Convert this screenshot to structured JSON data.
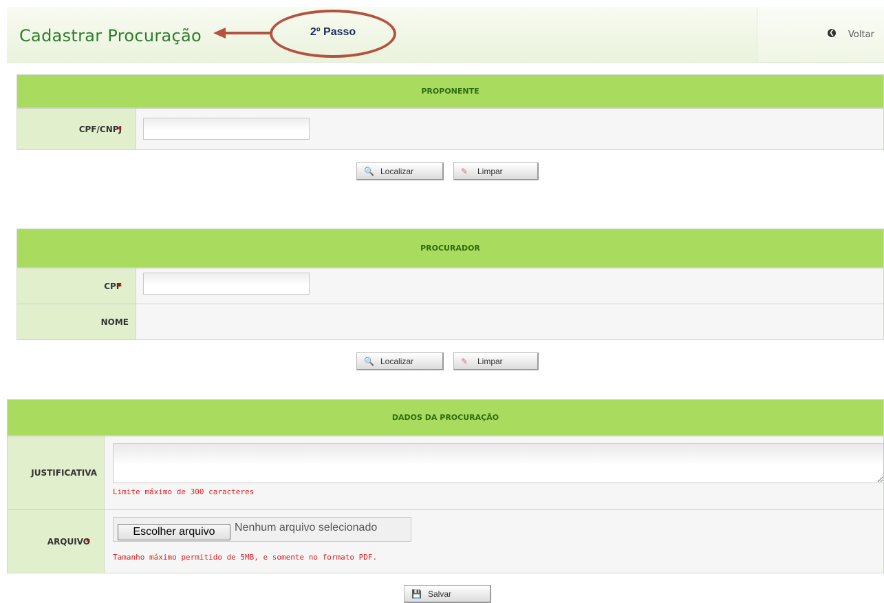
{
  "header": {
    "title": "Cadastrar Procuração",
    "annotation": "2º Passo",
    "back_label": "Voltar"
  },
  "proponente": {
    "heading": "PROPONENTE",
    "cpf_cnpj_label": "CPF/CNPJ",
    "required_mark": "*",
    "cpf_cnpj_value": "",
    "search_button": "Localizar",
    "clear_button": "Limpar"
  },
  "procurador": {
    "heading": "PROCURADOR",
    "cpf_label": "CPF",
    "required_mark": "*",
    "cpf_value": "",
    "nome_label": "NOME",
    "nome_value": "",
    "search_button": "Localizar",
    "clear_button": "Limpar"
  },
  "dados": {
    "heading": "DADOS DA PROCURAÇÃO",
    "justificativa_label": "JUSTIFICATIVA",
    "justificativa_value": "",
    "justificativa_hint": "Limite máximo de 300 caracteres",
    "arquivo_label": "ARQUIVO",
    "required_mark": "*",
    "file_button": "Escolher arquivo",
    "file_status": "Nenhum arquivo selecionado",
    "arquivo_hint": "Tamanho máximo permitido de 5MB, e somente no formato PDF."
  },
  "save_button": "Salvar",
  "colors": {
    "accent_green": "#a9dc5e",
    "title_green": "#2f7d2a",
    "annotation_red": "#b5523f",
    "required_red": "#d10000"
  },
  "icons": {
    "search": "magnifier-icon",
    "clear": "eraser-icon",
    "save": "floppy-disk-icon",
    "back": "back-circle-icon"
  }
}
